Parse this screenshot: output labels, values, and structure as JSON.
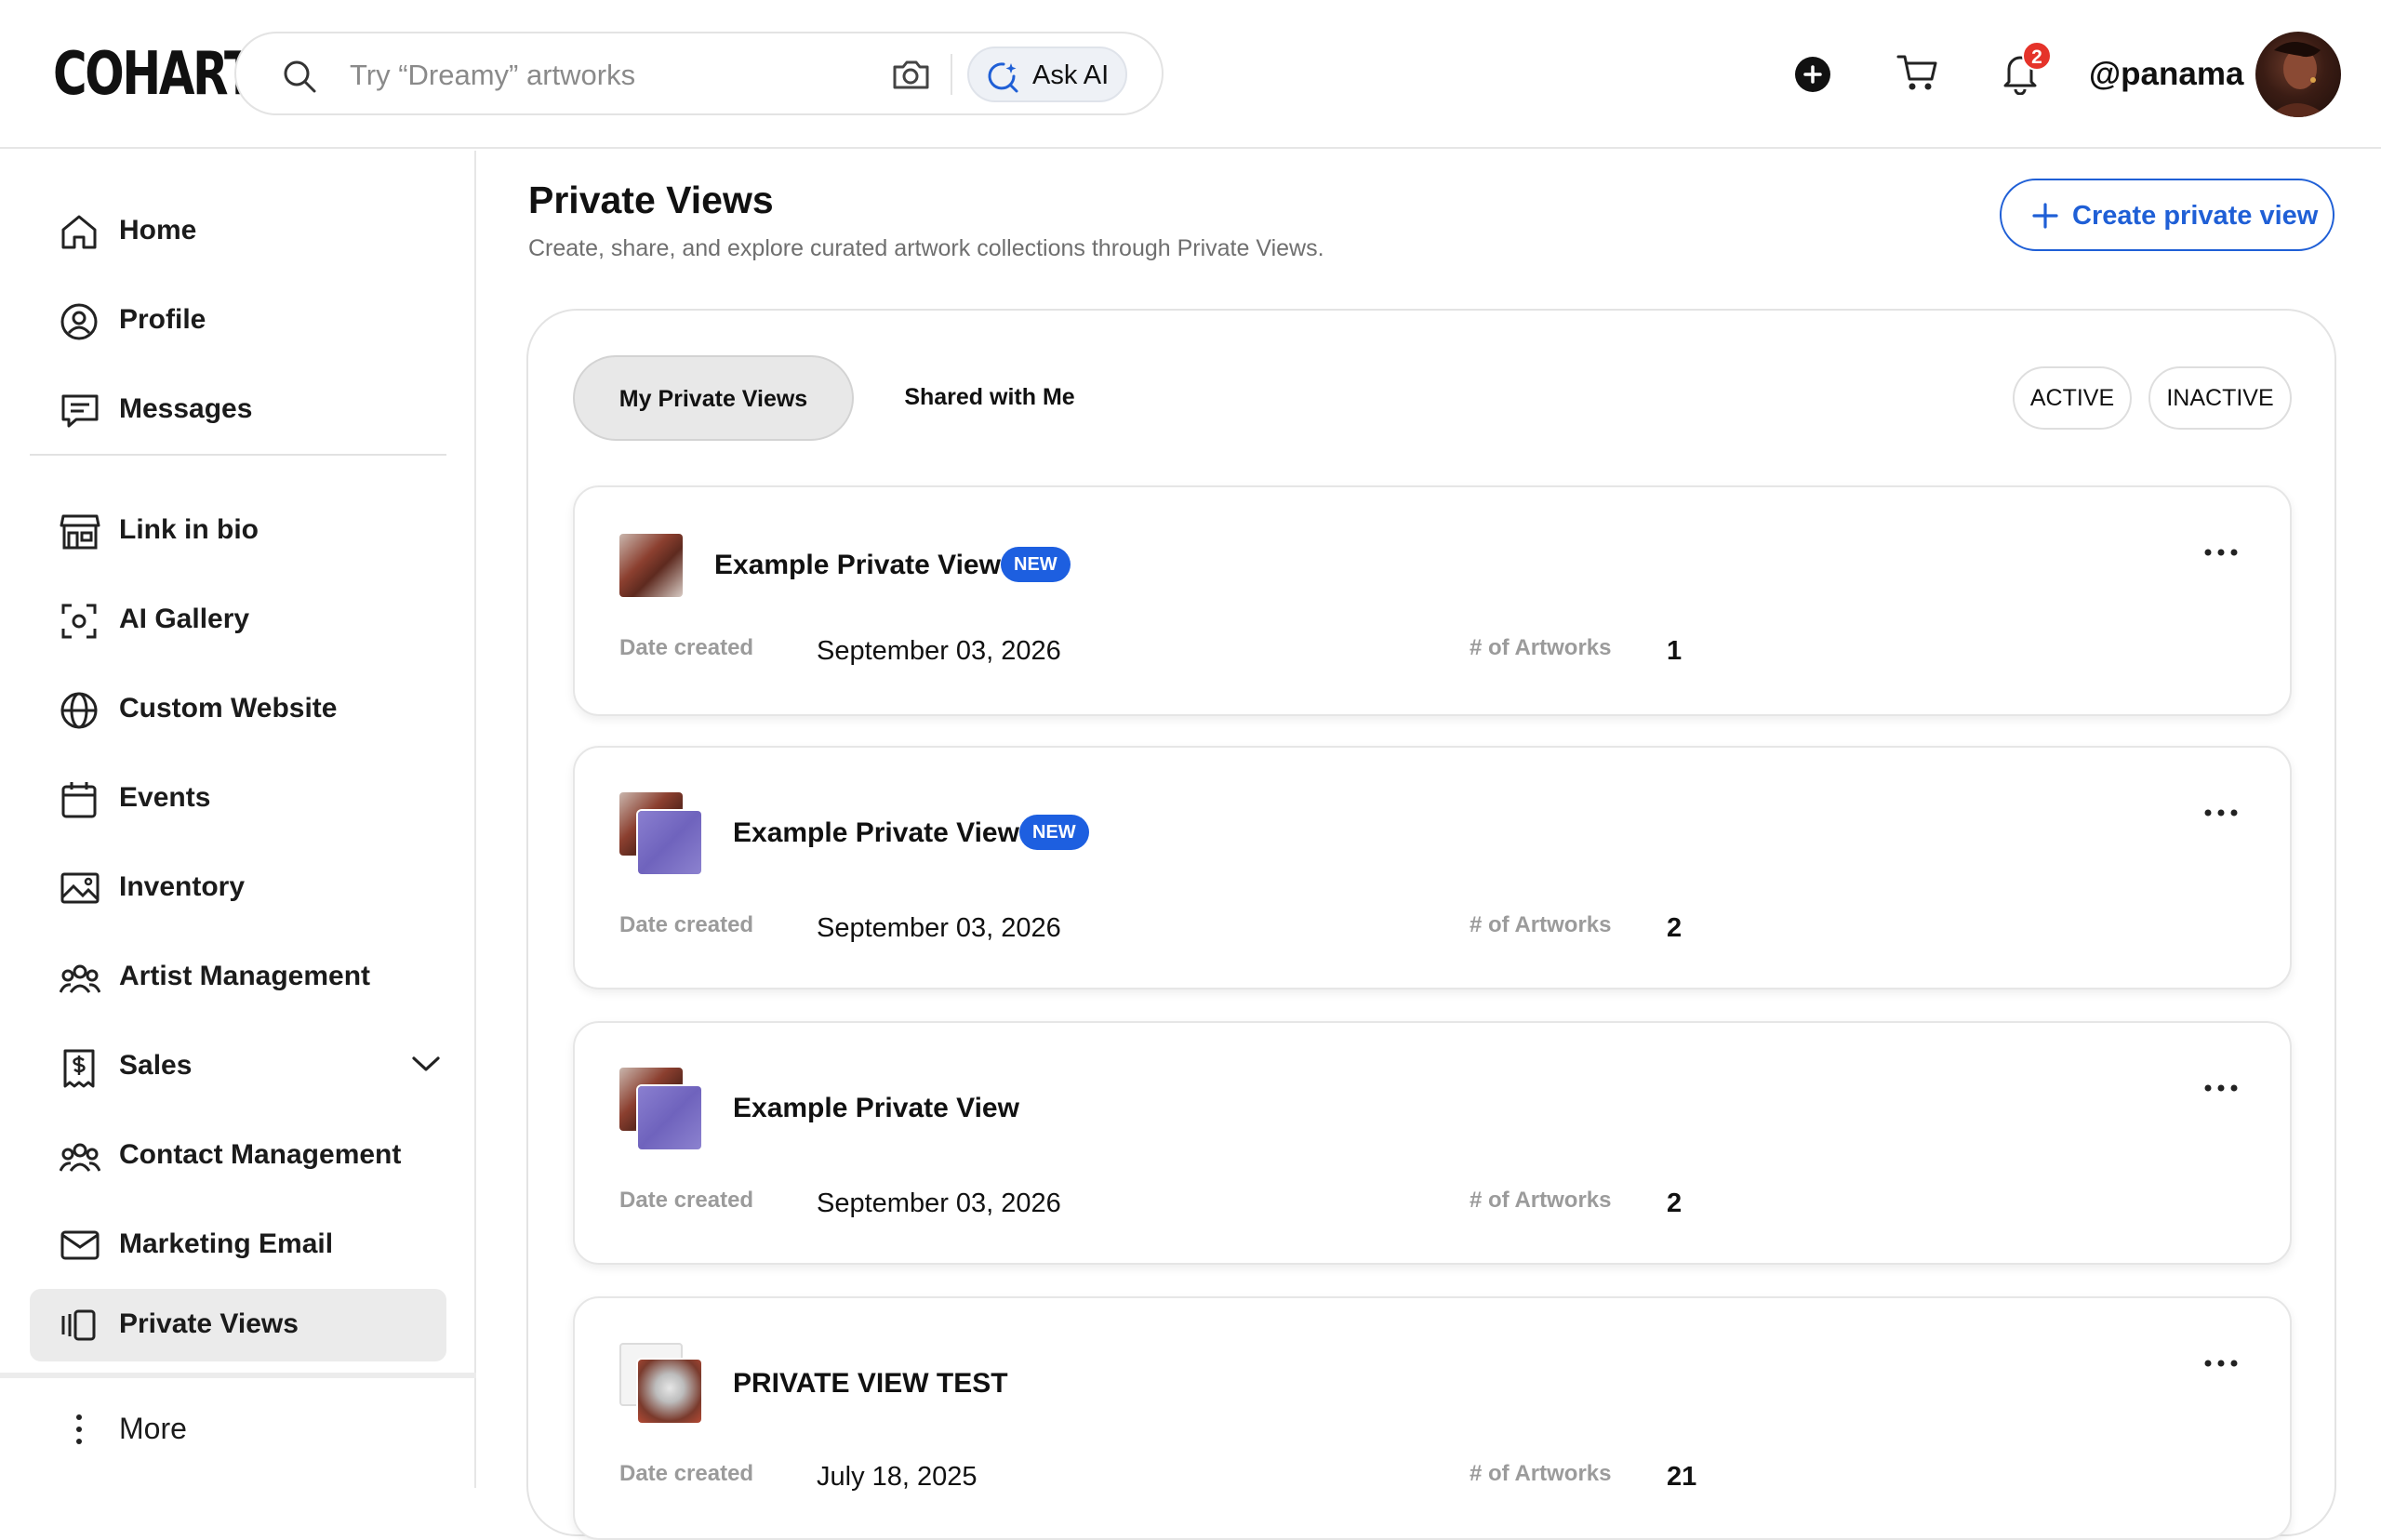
{
  "app": {
    "logo": "COHART"
  },
  "header": {
    "search_placeholder": "Try “Dreamy” artworks",
    "ask_ai_label": "Ask AI",
    "notification_count": "2",
    "username": "@panama"
  },
  "sidebar": {
    "items": [
      {
        "label": "Home",
        "icon": "home-icon"
      },
      {
        "label": "Profile",
        "icon": "user-circle-icon"
      },
      {
        "label": "Messages",
        "icon": "message-icon"
      },
      {
        "label": "Link in bio",
        "icon": "store-icon"
      },
      {
        "label": "AI Gallery",
        "icon": "scan-icon"
      },
      {
        "label": "Custom Website",
        "icon": "globe-icon"
      },
      {
        "label": "Events",
        "icon": "calendar-icon"
      },
      {
        "label": "Inventory",
        "icon": "image-icon"
      },
      {
        "label": "Artist Management",
        "icon": "users-icon"
      },
      {
        "label": "Sales",
        "icon": "dollar-doc-icon"
      },
      {
        "label": "Contact Management",
        "icon": "users-icon"
      },
      {
        "label": "Marketing Email",
        "icon": "mail-icon"
      },
      {
        "label": "Private Views",
        "icon": "private-views-icon",
        "active": true
      }
    ],
    "more_label": "More"
  },
  "main": {
    "title": "Private Views",
    "subtitle": "Create, share, and explore curated artwork collections through Private Views.",
    "create_button": "Create private view",
    "tabs": [
      {
        "label": "My Private Views",
        "active": true
      },
      {
        "label": "Shared with Me",
        "active": false
      }
    ],
    "filters": [
      {
        "label": "ACTIVE"
      },
      {
        "label": "INACTIVE"
      }
    ],
    "date_label": "Date created",
    "count_label": "# of Artworks",
    "new_badge": "NEW",
    "cards": [
      {
        "title": "Example Private View",
        "is_new": true,
        "date": "September 03, 2026",
        "artworks": "1"
      },
      {
        "title": "Example Private View",
        "is_new": true,
        "date": "September 03, 2026",
        "artworks": "2"
      },
      {
        "title": "Example Private View",
        "is_new": false,
        "date": "September 03, 2026",
        "artworks": "2"
      },
      {
        "title": "PRIVATE VIEW TEST",
        "is_new": false,
        "date": "July 18, 2025",
        "artworks": "21"
      }
    ]
  },
  "colors": {
    "accent_blue": "#1f5fd6",
    "badge_blue": "#1d5fe0",
    "notification_red": "#e5332a",
    "active_nav_bg": "#ebebeb"
  }
}
